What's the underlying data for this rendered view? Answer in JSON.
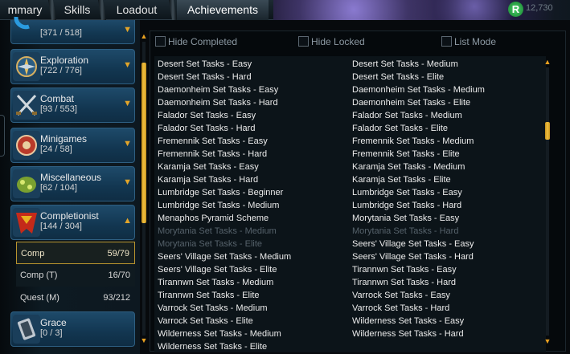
{
  "tabs": {
    "summary": "mmary",
    "skills": "Skills",
    "loadout": "Loadout",
    "achievements": "Achievements"
  },
  "header": {
    "points": "12,730"
  },
  "categories": {
    "top": {
      "count": "[371 / 518]"
    },
    "exploration": {
      "label": "Exploration",
      "count": "[722 / 776]"
    },
    "combat": {
      "label": "Combat",
      "count": "[93 / 553]"
    },
    "minigames": {
      "label": "Minigames",
      "count": "[24 / 58]"
    },
    "miscellaneous": {
      "label": "Miscellaneous",
      "count": "[62 / 104]"
    },
    "completionist": {
      "label": "Completionist",
      "count": "[144 / 304]"
    },
    "grace": {
      "label": "Grace",
      "count": "[0 / 3]"
    }
  },
  "subcategories": {
    "comp": {
      "label": "Comp",
      "value": "59/79"
    },
    "comp_t": {
      "label": "Comp (T)",
      "value": "16/70"
    },
    "quest_m": {
      "label": "Quest (M)",
      "value": "93/212"
    }
  },
  "filters": {
    "hide_completed": "Hide Completed",
    "hide_locked": "Hide Locked",
    "list_mode": "List Mode"
  },
  "achievements": {
    "left": [
      "Desert Set Tasks - Easy",
      "Desert Set Tasks - Hard",
      "Daemonheim Set Tasks - Easy",
      "Daemonheim Set Tasks - Hard",
      "Falador Set Tasks - Easy",
      "Falador Set Tasks - Hard",
      "Fremennik Set Tasks - Easy",
      "Fremennik Set Tasks - Hard",
      "Karamja Set Tasks - Easy",
      "Karamja Set Tasks - Hard",
      "Lumbridge Set Tasks - Beginner",
      "Lumbridge Set Tasks - Medium",
      "Menaphos Pyramid Scheme",
      "Morytania Set Tasks - Medium",
      "Morytania Set Tasks - Elite",
      "Seers' Village Set Tasks - Medium",
      "Seers' Village Set Tasks - Elite",
      "Tirannwn Set Tasks - Medium",
      "Tirannwn Set Tasks - Elite",
      "Varrock Set Tasks - Medium",
      "Varrock Set Tasks - Elite",
      "Wilderness Set Tasks - Medium",
      "Wilderness Set Tasks - Elite"
    ],
    "right": [
      "Desert Set Tasks - Medium",
      "Desert Set Tasks - Elite",
      "Daemonheim Set Tasks - Medium",
      "Daemonheim Set Tasks - Elite",
      "Falador Set Tasks - Medium",
      "Falador Set Tasks - Elite",
      "Fremennik Set Tasks - Medium",
      "Fremennik Set Tasks - Elite",
      "Karamja Set Tasks - Medium",
      "Karamja Set Tasks - Elite",
      "Lumbridge Set Tasks - Easy",
      "Lumbridge Set Tasks - Hard",
      "Morytania Set Tasks - Easy",
      "Morytania Set Tasks - Hard",
      "Seers' Village Set Tasks - Easy",
      "Seers' Village Set Tasks - Hard",
      "Tirannwn Set Tasks - Easy",
      "Tirannwn Set Tasks - Hard",
      "Varrock Set Tasks - Easy",
      "Varrock Set Tasks - Hard",
      "Wilderness Set Tasks - Easy",
      "Wilderness Set Tasks - Hard"
    ]
  },
  "colors": {
    "accent_gold": "#e8a020",
    "row_text": "#ececec",
    "row_locked": "#56626b",
    "category_blue": "#123650"
  }
}
